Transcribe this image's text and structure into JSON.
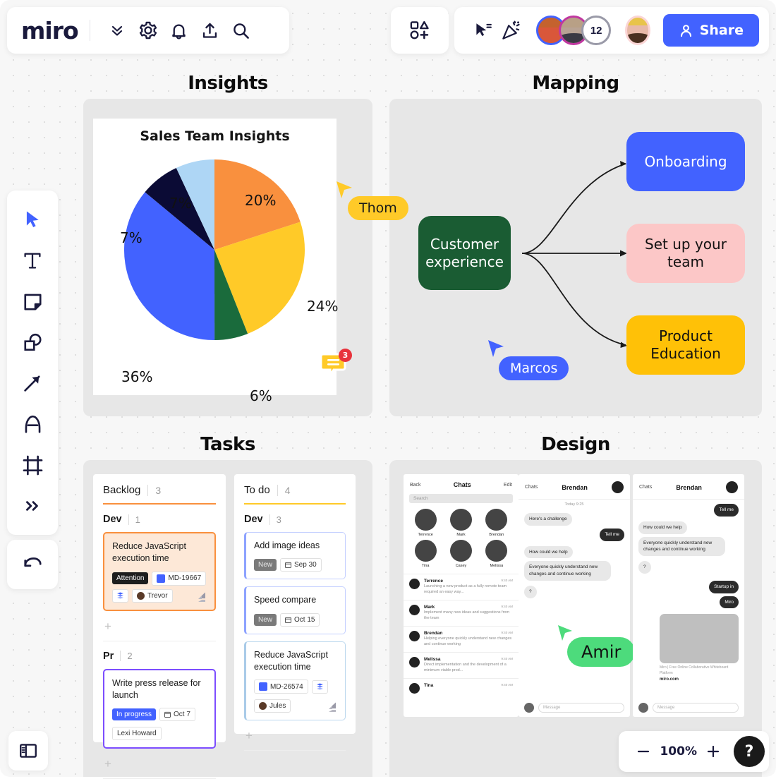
{
  "app": {
    "logo": "miro"
  },
  "topbar": {
    "left_icons": [
      {
        "name": "chevrons-down-icon",
        "label": "Expand menu"
      },
      {
        "name": "gear-icon",
        "label": "Settings"
      },
      {
        "name": "bell-icon",
        "label": "Notifications"
      },
      {
        "name": "upload-icon",
        "label": "Upload"
      },
      {
        "name": "search-icon",
        "label": "Search"
      }
    ],
    "templates_icon": "shapes-plus-icon",
    "cursor_icon": "cursor-select-icon",
    "celebrate_icon": "party-popper-icon",
    "avatars": [
      {
        "name": "avatar-user-1",
        "ring": "#4262ff"
      },
      {
        "name": "avatar-user-2",
        "ring": "#c037a0"
      },
      {
        "name": "avatar-count",
        "count": "12",
        "ring": "#9a9aa8"
      }
    ],
    "current_user_avatar": "avatar-current-user",
    "share_label": "Share"
  },
  "left_toolbar": {
    "tools": [
      {
        "name": "select-tool",
        "label": "Select",
        "active": true
      },
      {
        "name": "text-tool",
        "label": "Text"
      },
      {
        "name": "sticky-note-tool",
        "label": "Sticky note"
      },
      {
        "name": "shapes-tool",
        "label": "Shapes"
      },
      {
        "name": "arrow-tool",
        "label": "Connection line"
      },
      {
        "name": "pen-tool",
        "label": "Pen"
      },
      {
        "name": "frame-tool",
        "label": "Frame"
      },
      {
        "name": "more-tools",
        "label": "More apps"
      }
    ],
    "undo_label": "Undo"
  },
  "bottom_left": {
    "panel_toggle": "open-panel-icon"
  },
  "zoom_control": {
    "minus_label": "−",
    "level": "100%",
    "plus_label": "+",
    "help_label": "?"
  },
  "frames": {
    "insights": "Insights",
    "mapping": "Mapping",
    "tasks": "Tasks",
    "design": "Design"
  },
  "chart_data": {
    "type": "pie",
    "title": "Sales Team Insights",
    "categories": [
      "Orange",
      "Yellow",
      "Green",
      "Blue",
      "Navy",
      "Light Blue"
    ],
    "labels": [
      "20%",
      "24%",
      "6%",
      "36%",
      "7%",
      "7%"
    ],
    "values": [
      20,
      24,
      6,
      36,
      7,
      7
    ],
    "colors": [
      "#f9903e",
      "#ffca28",
      "#1a6b3c",
      "#4262ff",
      "#0b0b35",
      "#aed6f5"
    ],
    "start_angle": 0,
    "legend": "none",
    "label_position": "outside"
  },
  "collab_cursors": [
    {
      "name": "Thom",
      "color": "#ffca28",
      "text_color": "#1a1a1a"
    },
    {
      "name": "Marcos",
      "color": "#4262ff",
      "text_color": "#ffffff"
    },
    {
      "name": "Amir",
      "color": "#4ddb7c",
      "text_color": "#111111"
    }
  ],
  "comment_badge": {
    "count": "3"
  },
  "mapping": {
    "root": {
      "label": "Customer experience",
      "color": "#1a5c33",
      "text": "#ffffff"
    },
    "children": [
      {
        "label": "Onboarding",
        "color": "#4262ff",
        "text": "#ffffff"
      },
      {
        "label": "Set up your team",
        "color": "#fcc7c7",
        "text": "#111111"
      },
      {
        "label": "Product Education",
        "color": "#ffc107",
        "text": "#111111"
      }
    ]
  },
  "tasks": {
    "columns": [
      {
        "title": "Backlog",
        "count": "3",
        "rule_color": "#f9903e",
        "groups": [
          {
            "title": "Dev",
            "count": "1",
            "cards": [
              {
                "title": "Reduce JavaScript execution time",
                "border": "#f9903e",
                "bg": "#fde8d7",
                "chips": [
                  {
                    "type": "dark",
                    "text": "Attention"
                  },
                  {
                    "type": "jira",
                    "text": "MD-19667"
                  },
                  {
                    "type": "icon",
                    "text": "jira-icon"
                  }
                ],
                "assignee": "Trevor",
                "has_jira_logo": true
              }
            ]
          },
          {
            "title": "Pr",
            "count": "2",
            "cards": [
              {
                "title": "Write press release for launch",
                "border": "#7c4dff",
                "bg": "#ffffff",
                "chips": [
                  {
                    "type": "blue",
                    "text": "In progress"
                  },
                  {
                    "type": "date",
                    "text": "Oct 7"
                  }
                ],
                "assignee": "Lexi Howard",
                "has_jira_logo": false
              }
            ]
          }
        ]
      },
      {
        "title": "To do",
        "count": "4",
        "rule_color": "#ffca28",
        "groups": [
          {
            "title": "Dev",
            "count": "3",
            "cards": [
              {
                "title": "Add image ideas",
                "border": "#8da2ff",
                "bg": "#ffffff",
                "chips": [
                  {
                    "type": "gray",
                    "text": "New"
                  },
                  {
                    "type": "date",
                    "text": "Sep 30"
                  }
                ],
                "assignee": "",
                "has_jira_logo": false
              },
              {
                "title": "Speed compare",
                "border": "#8da2ff",
                "bg": "#ffffff",
                "chips": [
                  {
                    "type": "gray",
                    "text": "New"
                  },
                  {
                    "type": "date",
                    "text": "Oct 15"
                  }
                ],
                "assignee": "",
                "has_jira_logo": false
              },
              {
                "title": "Reduce JavaScript execution time",
                "border": "#a9cbe8",
                "bg": "#ffffff",
                "chips": [
                  {
                    "type": "jira",
                    "text": "MD-26574"
                  },
                  {
                    "type": "icon",
                    "text": "jira-icon"
                  }
                ],
                "assignee": "Jules",
                "has_jira_logo": true
              }
            ]
          }
        ]
      }
    ],
    "add_label": "+"
  },
  "design": {
    "screen1": {
      "back": "Back",
      "title": "Chats",
      "edit": "Edit",
      "search_placeholder": "Search",
      "people": [
        "Terrence",
        "Mark",
        "Brendan",
        "Tina",
        "Casey",
        "Melissa"
      ],
      "threads": [
        {
          "name": "Terrence",
          "time": "9:40 AM",
          "msg": "Launching a new product as a fully remote team required an easy way..."
        },
        {
          "name": "Mark",
          "time": "9:40 AM",
          "msg": "Implement many new ideas and suggestions from the team"
        },
        {
          "name": "Brendan",
          "time": "9:40 AM",
          "msg": "Helping everyone quickly understand new changes and continue working"
        },
        {
          "name": "Melissa",
          "time": "9:40 AM",
          "msg": "Direct implementation and the development of a minimum viable prod..."
        },
        {
          "name": "Tina",
          "time": "9:40 AM",
          "msg": ""
        }
      ]
    },
    "screen2": {
      "back": "Chats",
      "title": "Brendan",
      "daystamp": "Today 9:25",
      "messages": [
        {
          "side": "left",
          "text": "Here's a challenge"
        },
        {
          "side": "right",
          "text": "Tell me"
        },
        {
          "side": "left",
          "text": "How could we help"
        },
        {
          "side": "left",
          "text": "Everyone quickly understand new changes and continue working"
        },
        {
          "side": "left",
          "text": "?"
        }
      ],
      "input_placeholder": "Message"
    },
    "screen3": {
      "back": "Chats",
      "title": "Brendan",
      "messages": [
        {
          "side": "right",
          "text": "Tell me"
        },
        {
          "side": "left",
          "text": "How could we help"
        },
        {
          "side": "left",
          "text": "Everyone quickly understand new changes and continue working"
        },
        {
          "side": "left",
          "text": "?"
        },
        {
          "side": "right",
          "text": "Startup in"
        },
        {
          "side": "right",
          "text": "Miro"
        }
      ],
      "link_title": "Miro | Free Online Collaborative Whiteboard Platform",
      "link_url": "miro.com",
      "input_placeholder": "Message"
    }
  }
}
